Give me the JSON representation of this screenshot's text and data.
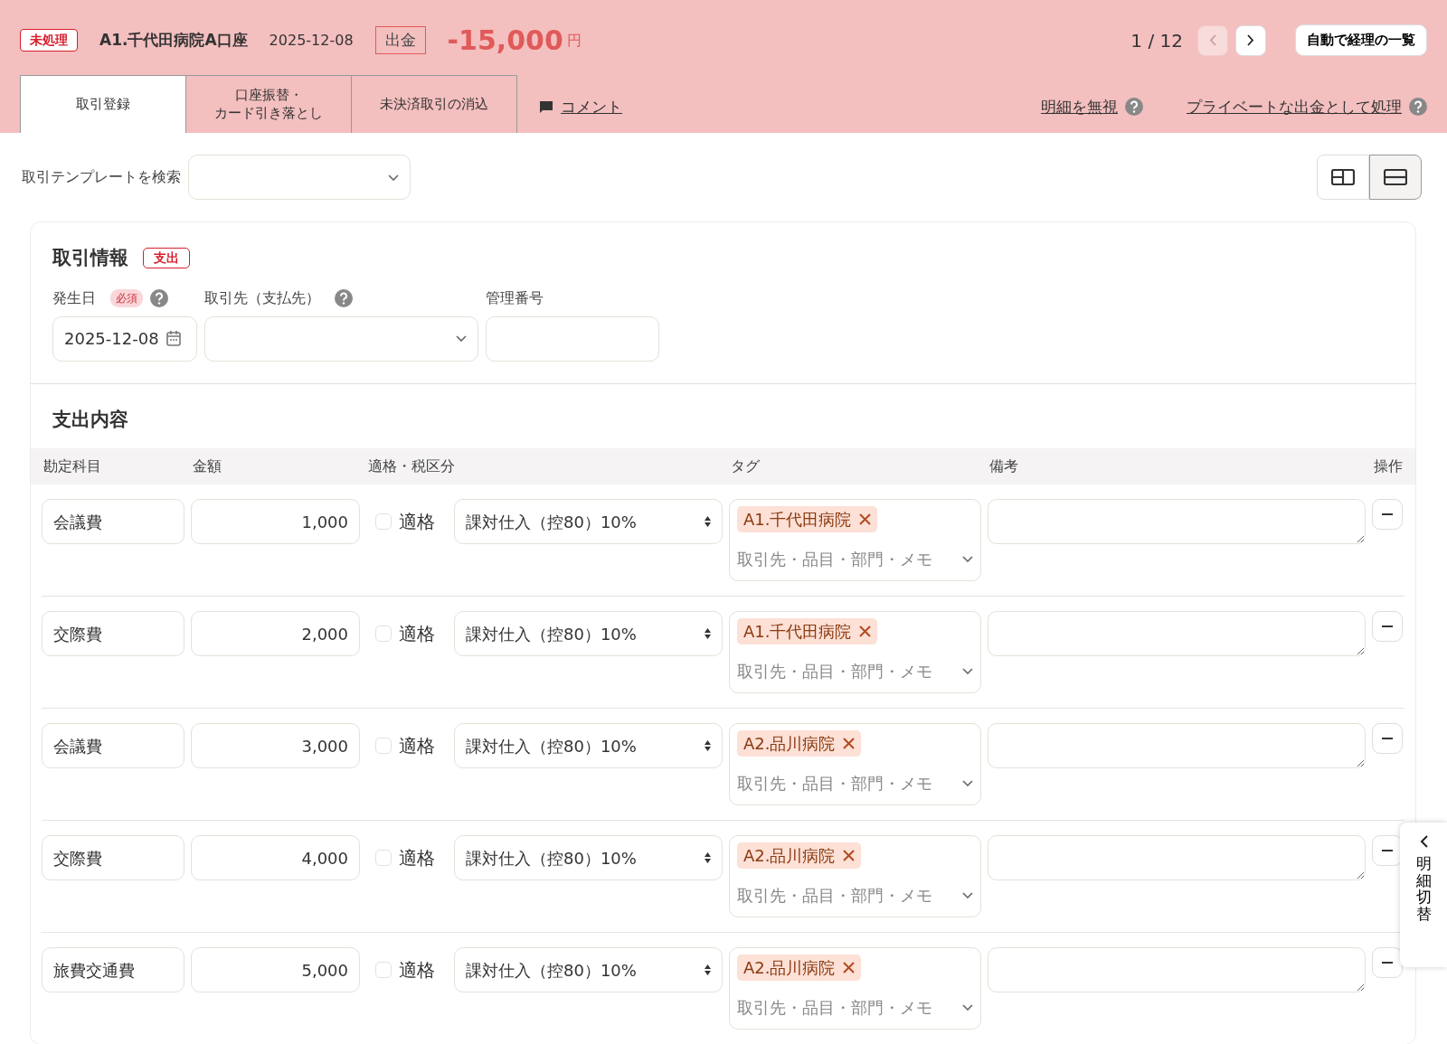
{
  "header": {
    "status_badge": "未処理",
    "account": "A1.千代田病院A口座",
    "date": "2025-12-08",
    "direction": "出金",
    "amount": "-15,000",
    "currency": "円",
    "pager": "1 / 12",
    "prev_disabled": true,
    "next_disabled": false,
    "list_button": "自動で経理の一覧"
  },
  "tabs": [
    {
      "label": "取引登録",
      "selected": true
    },
    {
      "label_lines": [
        "口座振替・",
        "カード引き落とし"
      ],
      "selected": false
    },
    {
      "label": "未決済取引の消込",
      "selected": false
    }
  ],
  "comment_link": "コメント",
  "header_links": [
    "明細を無視",
    "プライベートな出金として処理"
  ],
  "template_search": {
    "label": "取引テンプレートを検索"
  },
  "layout_toggle": [
    {
      "kind": "split",
      "selected": false
    },
    {
      "kind": "stacked",
      "selected": true
    }
  ],
  "transaction_info": {
    "title": "取引情報",
    "type_badge": "支出",
    "fields": [
      {
        "label": "発生日",
        "required_badge": "必須",
        "help": true,
        "kind": "date",
        "value": "2025-12-08"
      },
      {
        "label": "取引先（支払先）",
        "help": true,
        "kind": "select"
      },
      {
        "label": "管理番号",
        "help": false,
        "kind": "text"
      }
    ]
  },
  "expense": {
    "title": "支出内容",
    "columns": [
      "勘定科目",
      "金額",
      "適格・税区分",
      "タグ",
      "備考",
      "操作"
    ],
    "rows": [
      {
        "account": "会議費",
        "amount": "1,000",
        "qualified_label": "適格",
        "qualified": false,
        "tax": "課対仕入（控80）10%",
        "tags": [
          "A1.千代田病院"
        ],
        "tag_placeholder": "取引先・品目・部門・メモ"
      },
      {
        "account": "交際費",
        "amount": "2,000",
        "qualified_label": "適格",
        "qualified": false,
        "tax": "課対仕入（控80）10%",
        "tags": [
          "A1.千代田病院"
        ],
        "tag_placeholder": "取引先・品目・部門・メモ"
      },
      {
        "account": "会議費",
        "amount": "3,000",
        "qualified_label": "適格",
        "qualified": false,
        "tax": "課対仕入（控80）10%",
        "tags": [
          "A2.品川病院"
        ],
        "tag_placeholder": "取引先・品目・部門・メモ"
      },
      {
        "account": "交際費",
        "amount": "4,000",
        "qualified_label": "適格",
        "qualified": false,
        "tax": "課対仕入（控80）10%",
        "tags": [
          "A2.品川病院"
        ],
        "tag_placeholder": "取引先・品目・部門・メモ"
      },
      {
        "account": "旅費交通費",
        "amount": "5,000",
        "qualified_label": "適格",
        "qualified": false,
        "tax": "課対仕入（控80）10%",
        "tags": [
          "A2.品川病院"
        ],
        "tag_placeholder": "取引先・品目・部門・メモ"
      }
    ]
  },
  "side_tab": "明細切替"
}
